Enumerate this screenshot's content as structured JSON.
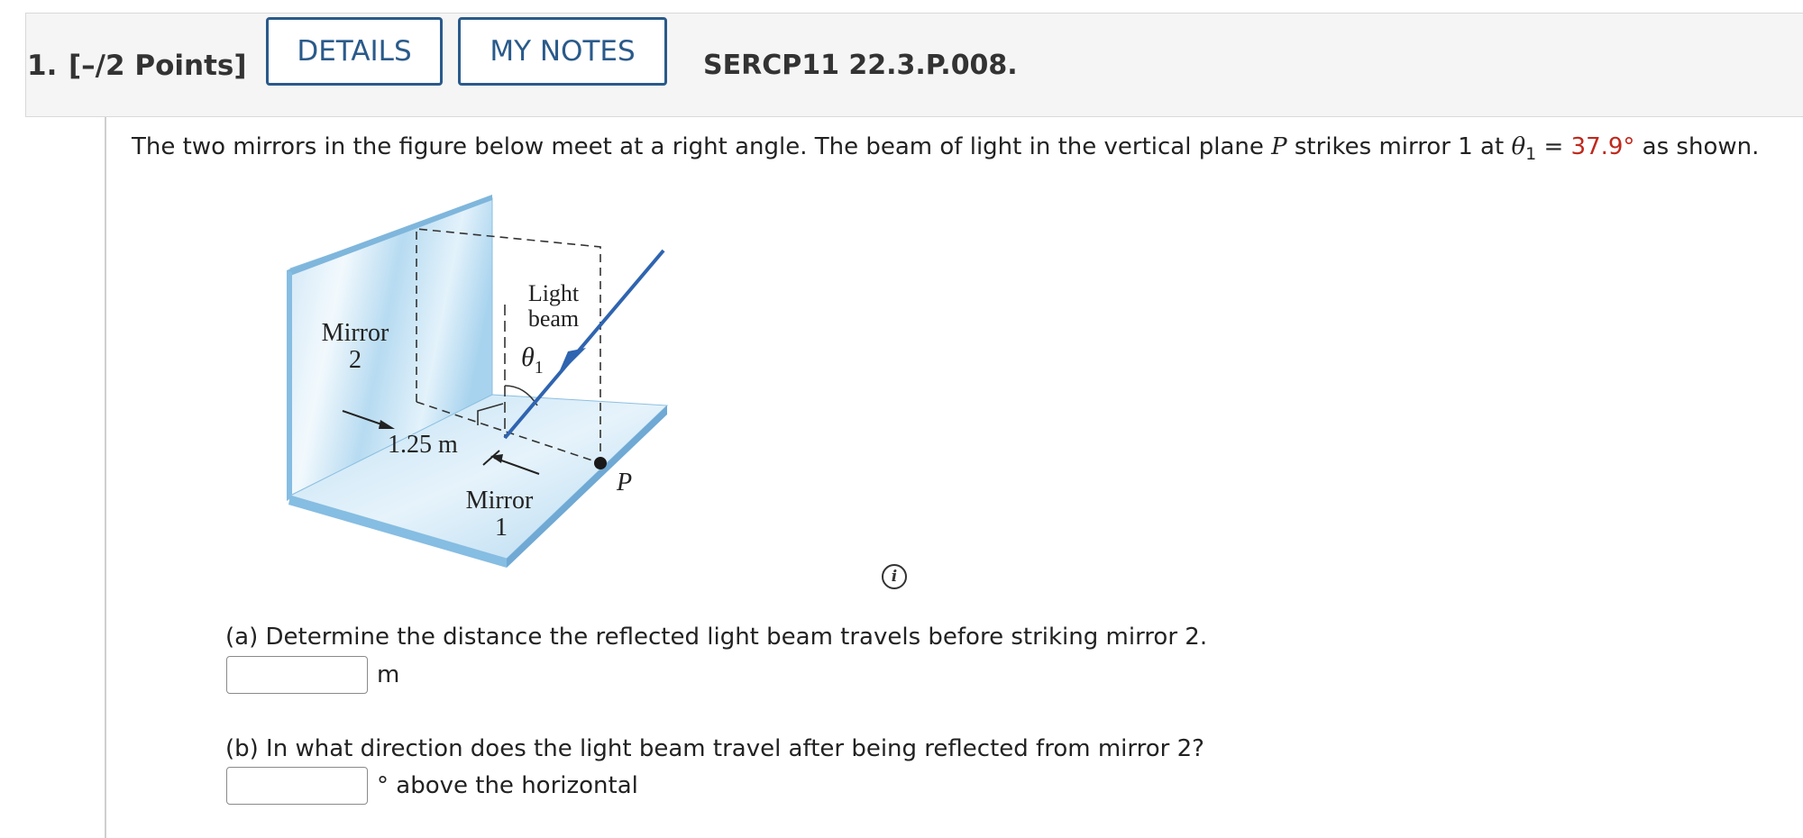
{
  "header": {
    "question_number": "1.",
    "points": "[–/2 Points]",
    "details_label": "DETAILS",
    "my_notes_label": "MY NOTES",
    "question_id": "SERCP11 22.3.P.008."
  },
  "prompt": {
    "text_before": "The two mirrors in the figure below meet at a right angle. The beam of light in the vertical plane ",
    "plane_symbol": "P",
    "text_middle": " strikes mirror 1 at ",
    "angle_symbol": "θ",
    "angle_subscript": "1",
    "equals": " = ",
    "angle_value": "37.9°",
    "text_after": " as shown."
  },
  "figure": {
    "mirror2_label_line1": "Mirror",
    "mirror2_label_line2": "2",
    "mirror1_label_line1": "Mirror",
    "mirror1_label_line2": "1",
    "light_beam_line1": "Light",
    "light_beam_line2": "beam",
    "theta_symbol": "θ",
    "theta_subscript": "1",
    "distance_label": "1.25 m",
    "point_label": "P",
    "colors": {
      "mirror_light": "#dbeefa",
      "mirror_mid": "#a9d4ef",
      "beam": "#2f64b0"
    }
  },
  "info_icon": {
    "glyph": "i",
    "icon": "info-icon"
  },
  "part_a": {
    "question": "(a) Determine the distance the reflected light beam travels before striking mirror 2.",
    "value": "",
    "unit": "m"
  },
  "part_b": {
    "question": "(b) In what direction does the light beam travel after being reflected from mirror 2?",
    "value": "",
    "unit": "° above the horizontal"
  }
}
